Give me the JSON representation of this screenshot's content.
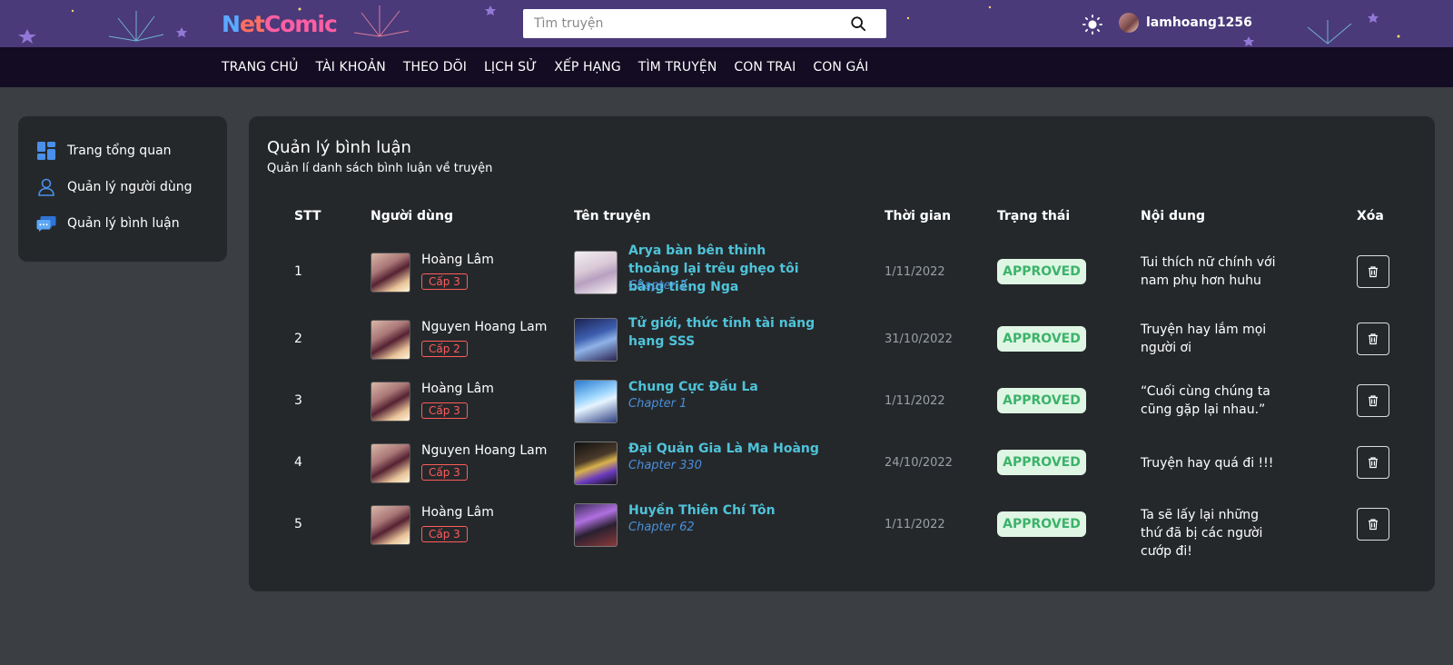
{
  "header": {
    "logo": {
      "n": "N",
      "et": "et",
      "comic": "Comic"
    },
    "search": {
      "placeholder": "Tìm truyện",
      "value": ""
    },
    "username": "lamhoang1256"
  },
  "nav": [
    "TRANG CHỦ",
    "TÀI KHOẢN",
    "THEO DÕI",
    "LỊCH SỬ",
    "XẾP HẠNG",
    "TÌM TRUYỆN",
    "CON TRAI",
    "CON GÁI"
  ],
  "sidebar": [
    {
      "label": "Trang tổng quan",
      "icon": "dashboard-icon"
    },
    {
      "label": "Quản lý người dùng",
      "icon": "user-icon"
    },
    {
      "label": "Quản lý bình luận",
      "icon": "comments-icon"
    }
  ],
  "page": {
    "title": "Quản lý bình luận",
    "subtitle": "Quản lí danh sách bình luận về truyện"
  },
  "table": {
    "headers": [
      "STT",
      "Người dùng",
      "Tên truyện",
      "Thời gian",
      "Trạng thái",
      "Nội dung",
      "Xóa"
    ],
    "rows": [
      {
        "stt": "1",
        "user": "Hoàng Lâm",
        "level": "Cấp 3",
        "title": "Arya bàn bên thỉnh thoảng lại trêu ghẹo tôi bằng tiếng Nga",
        "chapter": "Chapter 2",
        "time": "1/11/2022",
        "status": "APPROVED",
        "content": "Tui thích nữ chính với nam phụ hơn huhu"
      },
      {
        "stt": "2",
        "user": "Nguyen Hoang Lam",
        "level": "Cấp 2",
        "title": "Tử giới, thức tỉnh tài năng hạng SSS",
        "chapter": "",
        "time": "31/10/2022",
        "status": "APPROVED",
        "content": "Truyện hay lắm mọi người ơi"
      },
      {
        "stt": "3",
        "user": "Hoàng Lâm",
        "level": "Cấp 3",
        "title": "Chung Cực Đấu La",
        "chapter": "Chapter 1",
        "time": "1/11/2022",
        "status": "APPROVED",
        "content": "“Cuối cùng chúng ta cũng gặp lại nhau.”"
      },
      {
        "stt": "4",
        "user": "Nguyen Hoang Lam",
        "level": "Cấp 3",
        "title": "Đại Quản Gia Là Ma Hoàng",
        "chapter": "Chapter 330",
        "time": "24/10/2022",
        "status": "APPROVED",
        "content": "Truyện hay quá đi !!!"
      },
      {
        "stt": "5",
        "user": "Hoàng Lâm",
        "level": "Cấp 3",
        "title": "Huyền Thiên Chí Tôn",
        "chapter": "Chapter 62",
        "time": "1/11/2022",
        "status": "APPROVED",
        "content": "Ta sẽ lấy lại những thứ đã bị các người cướp đi!"
      }
    ]
  },
  "colors": {
    "accent": "#4fc3d9",
    "status_bg": "#dff6e4",
    "status_fg": "#3cb36b",
    "badge": "#ff5b5b"
  }
}
